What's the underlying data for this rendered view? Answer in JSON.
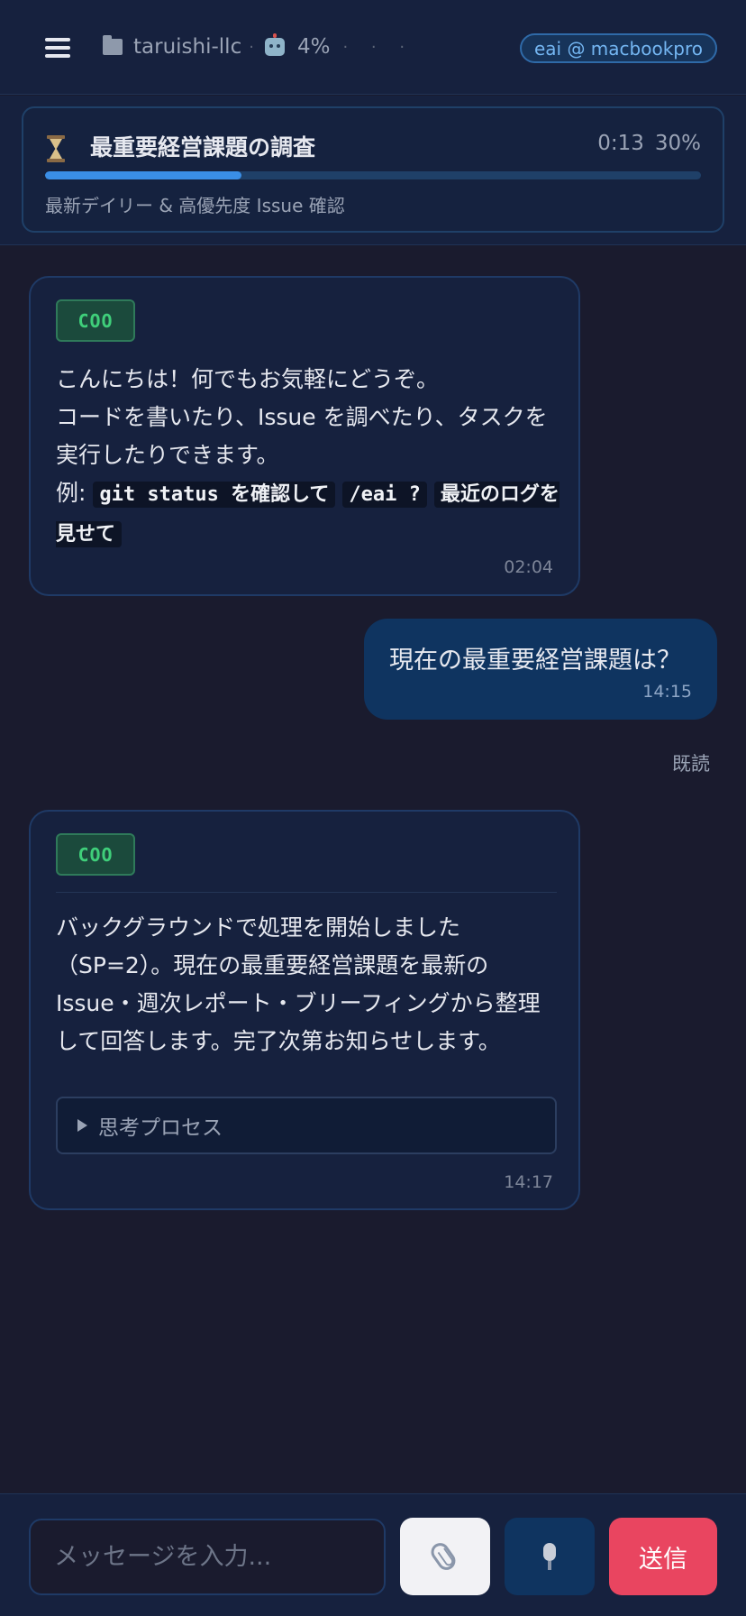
{
  "header": {
    "menu_icon": "hamburger-menu-icon",
    "folder_icon": "folder-icon",
    "workspace": "taruishi-llc",
    "separator": "·",
    "robot_icon": "robot-icon",
    "usage": "4%",
    "activity_dots": "· · ·",
    "host": "eai @ macbookpro"
  },
  "task": {
    "icon": "hourglass-icon",
    "title": "最重要経営課題の調査",
    "elapsed": "0:13",
    "progress_label": "30%",
    "progress": 0.3,
    "subtitle": "最新デイリー & 高優先度 Issue 確認",
    "accent": "#3a8ee6"
  },
  "messages": {
    "bot1": {
      "role": "COO",
      "line1": "こんにちは！何でもお気軽にどうぞ。",
      "line2": "コードを書いたり、Issue を調べたり、タスクを実行したりできます。",
      "example_prefix": "例: ",
      "example1": "git status を確認して",
      "example2": "/eai ?",
      "example3": "最近のログを見せて",
      "time": "02:04"
    },
    "user1": {
      "text": "現在の最重要経営課題は？",
      "time": "14:15",
      "read": "既読"
    },
    "bot2": {
      "role": "COO",
      "text": "バックグラウンドで処理を開始しました（SP=2）。現在の最重要経営課題を最新の Issue・週次レポート・ブリーフィングから整理して回答します。完了次第お知らせします。",
      "thinking_label": "思考プロセス",
      "time": "14:17"
    }
  },
  "composer": {
    "placeholder": "メッセージを入力...",
    "attach_icon": "paperclip-icon",
    "mic_icon": "microphone-icon",
    "send_label": "送信"
  },
  "colors": {
    "background": "#1a1b2e",
    "header": "#16213e",
    "user_bubble": "#0f3460",
    "send": "#e94560",
    "role_badge": "#3fcf7a"
  }
}
